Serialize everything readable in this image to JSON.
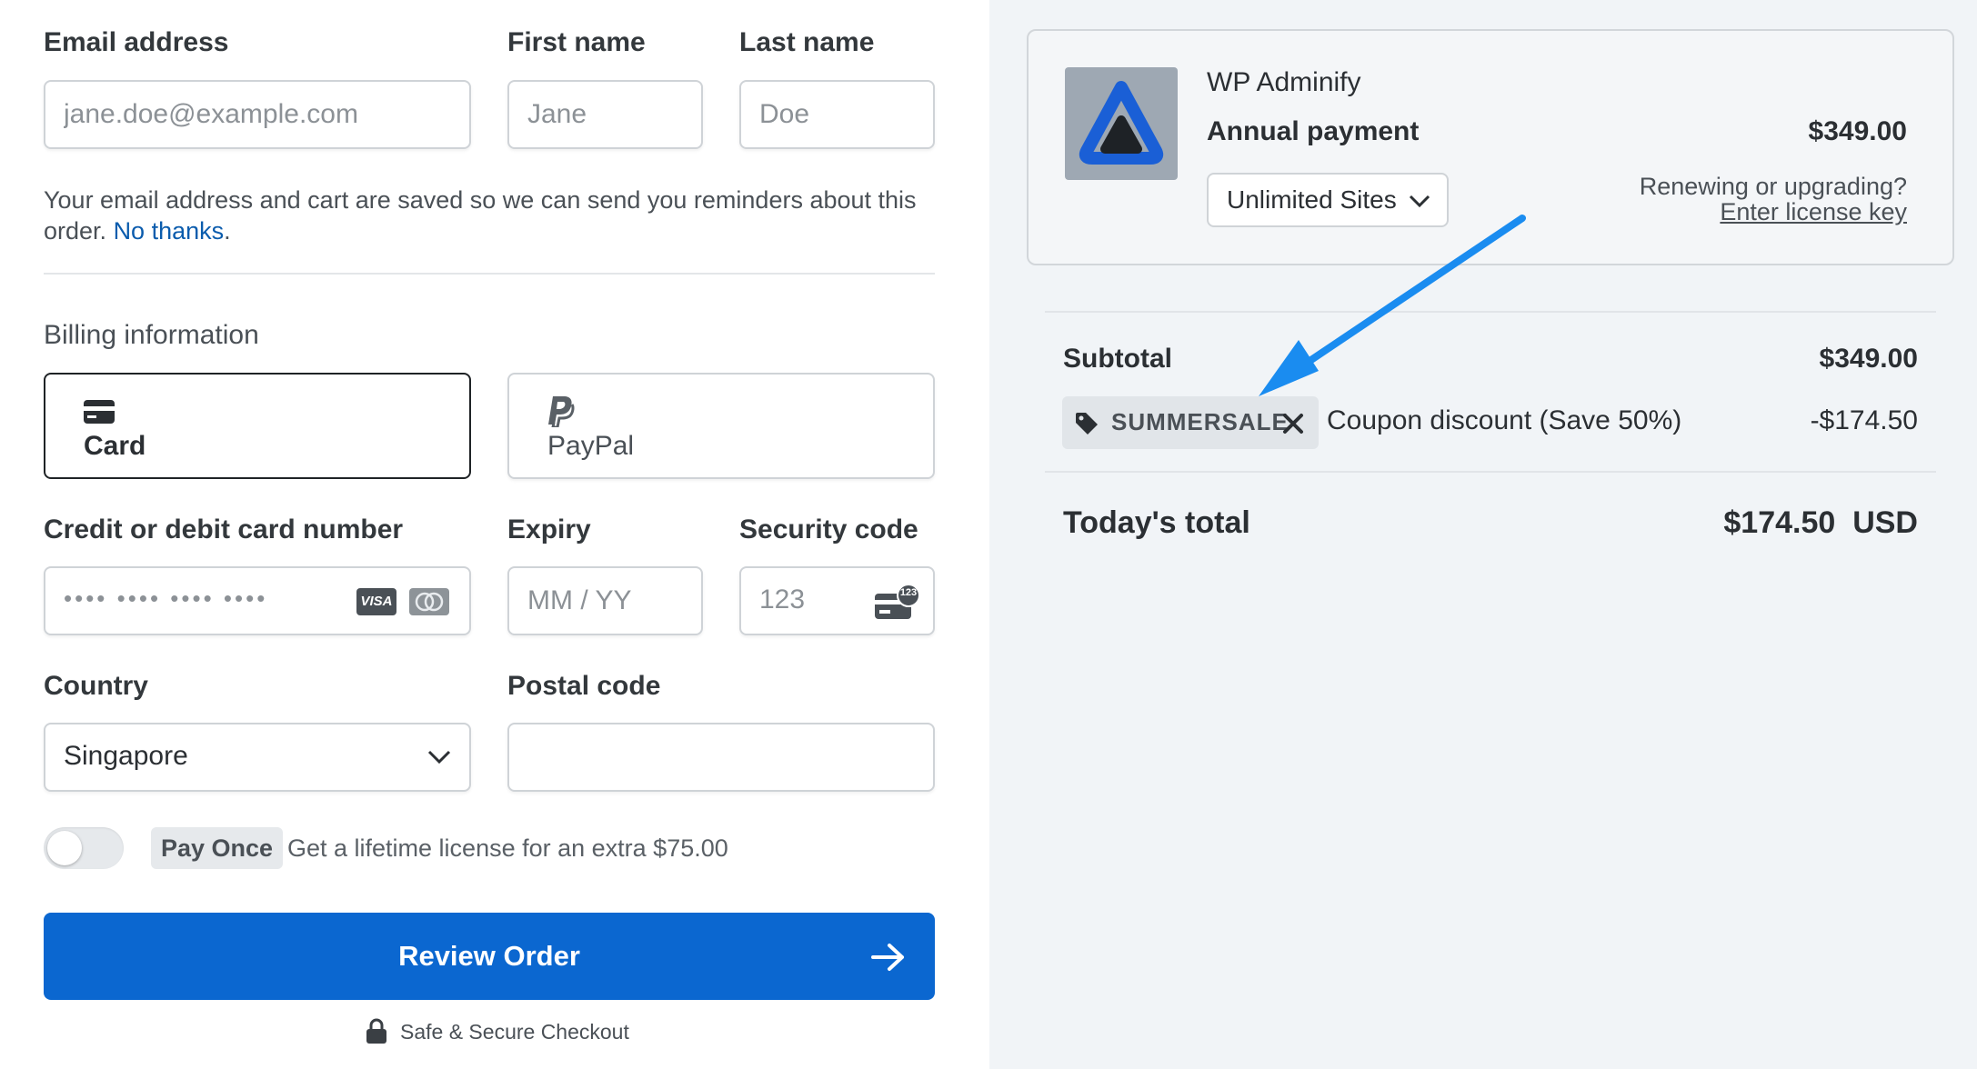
{
  "form": {
    "email_label": "Email address",
    "email_placeholder": "jane.doe@example.com",
    "first_name_label": "First name",
    "first_name_placeholder": "Jane",
    "last_name_label": "Last name",
    "last_name_placeholder": "Doe",
    "notice_text": "Your email address and cart are saved so we can send you reminders about this",
    "notice_text_2": "order.",
    "notice_link": "No thanks",
    "notice_end": "."
  },
  "billing": {
    "heading": "Billing information",
    "methods": [
      {
        "label": "Card",
        "selected": true,
        "icon": "credit-card-icon"
      },
      {
        "label": "PayPal",
        "selected": false,
        "icon": "paypal-icon"
      }
    ],
    "card_number_label": "Credit or debit card number",
    "card_number_placeholder": "•••• •••• •••• ••••",
    "card_brand_visa": "VISA",
    "expiry_label": "Expiry",
    "expiry_placeholder": "MM / YY",
    "security_label": "Security code",
    "security_placeholder": "123",
    "security_icon_badge": "123",
    "country_label": "Country",
    "country_value": "Singapore",
    "postal_label": "Postal code",
    "postal_value": ""
  },
  "pay_once": {
    "badge": "Pay Once",
    "text": "Get a lifetime license for an extra $75.00",
    "enabled": false
  },
  "review_button": {
    "label": "Review Order"
  },
  "secure_text": "Safe & Secure Checkout",
  "product": {
    "name": "WP Adminify",
    "plan": "Annual payment",
    "price": "$349.00",
    "option": "Unlimited Sites",
    "renew_text": "Renewing or upgrading?",
    "renew_link": "Enter license key"
  },
  "summary": {
    "subtotal_label": "Subtotal",
    "subtotal_value": "$349.00",
    "coupon_code": "SUMMERSALE",
    "coupon_label": "Coupon discount (Save 50%)",
    "coupon_value": "-$174.50",
    "total_label": "Today's total",
    "total_value": "$174.50",
    "total_currency": "USD"
  },
  "colors": {
    "accent": "#0b67d0",
    "link": "#0b5cad",
    "arrow": "#1a8cf0",
    "right_bg": "#f1f4f7"
  }
}
